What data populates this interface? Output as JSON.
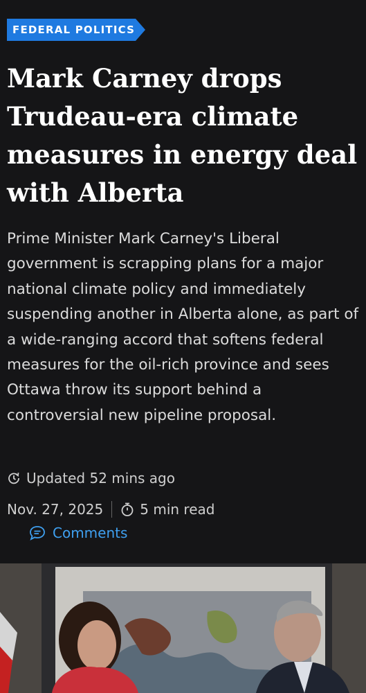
{
  "section_tag": "FEDERAL POLITICS",
  "headline": "Mark Carney drops Trudeau-era climate measures in energy deal with Alberta",
  "dek": "Prime Minister Mark Carney's Liberal government is scrapping plans for a major national climate policy and immediately suspending another in Alberta alone, as part of a wide-ranging accord that softens federal measures for the oil-rich province and sees Ottawa throw its support behind a controversial new pipeline proposal.",
  "meta": {
    "updated": "Updated 52 mins ago",
    "date": "Nov. 27, 2025",
    "read_time": "5 min read",
    "comments_label": "Comments"
  },
  "icons": {
    "updated": "refresh-clock-icon",
    "read_time": "stopwatch-icon",
    "comments": "speech-bubble-icon"
  },
  "colors": {
    "background": "#151517",
    "tag": "#1f7ae0",
    "link": "#3fa0f0"
  }
}
